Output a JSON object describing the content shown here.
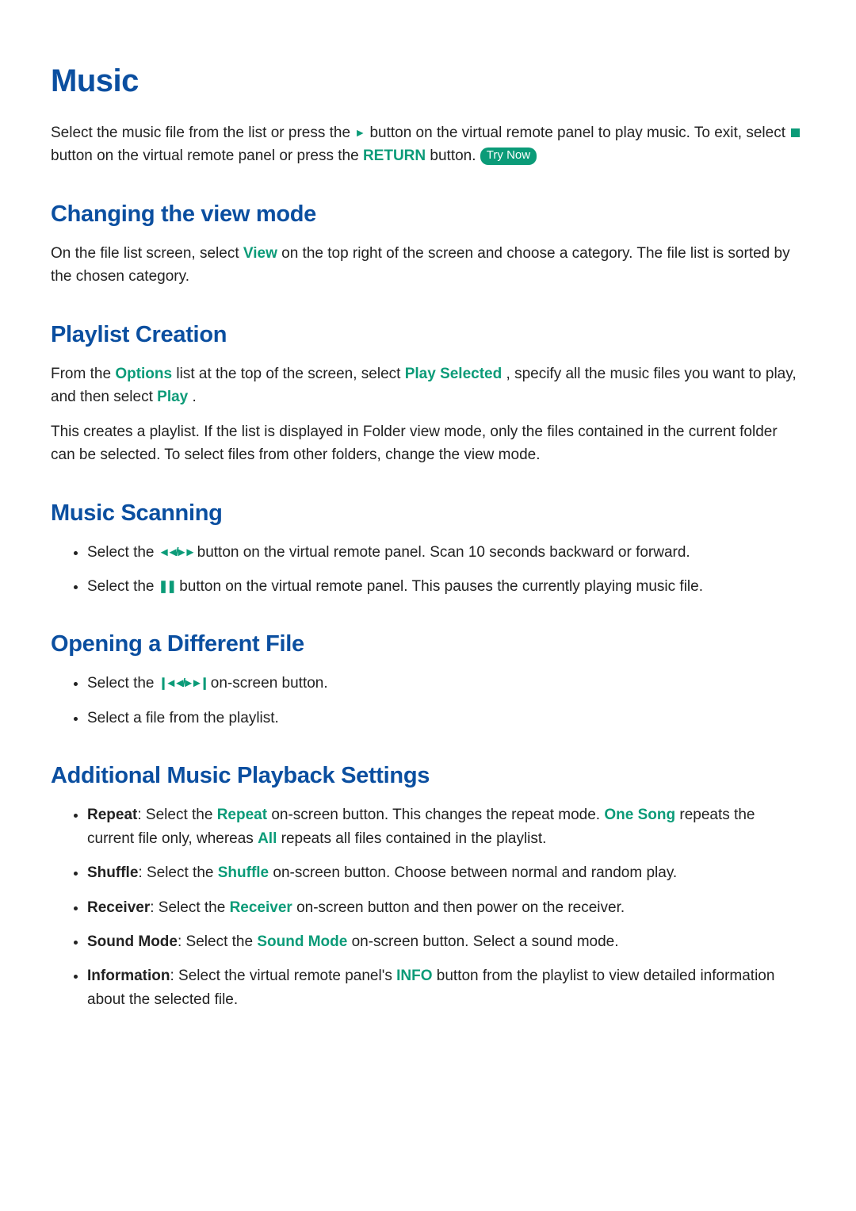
{
  "title": "Music",
  "intro": {
    "t1": "Select the music file from the list or press the ",
    "play_icon": "►",
    "t2": " button on the virtual remote panel to play music. To exit, select ",
    "stop_icon": "■",
    "t3": " button on the virtual remote panel or press the ",
    "return_label": "RETURN",
    "t4": " button. ",
    "try_now": "Try Now"
  },
  "sections": {
    "view": {
      "heading": "Changing the view mode",
      "p1a": "On the file list screen, select ",
      "view_label": "View",
      "p1b": " on the top right of the screen and choose a category. The file list is sorted by the chosen category."
    },
    "playlist": {
      "heading": "Playlist Creation",
      "p1a": "From the ",
      "options_label": "Options",
      "p1b": " list at the top of the screen, select ",
      "play_selected_label": "Play Selected",
      "p1c": ", specify all the music files you want to play, and then select ",
      "play_label": "Play",
      "p1d": ".",
      "p2": "This creates a playlist. If the list is displayed in Folder view mode, only the files contained in the current folder can be selected. To select files from other folders, change the view mode."
    },
    "scanning": {
      "heading": "Music Scanning",
      "li1a": "Select the ",
      "scan_icons": "◄◄/►►",
      "li1b": " button on the virtual remote panel. Scan 10 seconds backward or forward.",
      "li2a": "Select the ",
      "pause_icon": "❚❚",
      "li2b": " button on the virtual remote panel. This pauses the currently playing music file."
    },
    "different": {
      "heading": "Opening a Different File",
      "li1a": "Select the ",
      "skip_icons": "❙◄◄/►►❙",
      "li1b": " on-screen button.",
      "li2": "Select a file from the playlist."
    },
    "additional": {
      "heading": "Additional Music Playback Settings",
      "repeat": {
        "label": "Repeat",
        "t1": ": Select the ",
        "btn": "Repeat",
        "t2": " on-screen button. This changes the repeat mode. ",
        "one_song": "One Song",
        "t3": " repeats the current file only, whereas ",
        "all": "All",
        "t4": " repeats all files contained in the playlist."
      },
      "shuffle": {
        "label": "Shuffle",
        "t1": ": Select the ",
        "btn": "Shuffle",
        "t2": " on-screen button. Choose between normal and random play."
      },
      "receiver": {
        "label": "Receiver",
        "t1": ": Select the ",
        "btn": "Receiver",
        "t2": " on-screen button and then power on the receiver."
      },
      "sound": {
        "label": "Sound Mode",
        "t1": ": Select the ",
        "btn": "Sound Mode",
        "t2": " on-screen button. Select a sound mode."
      },
      "info": {
        "label": "Information",
        "t1": ": Select the virtual remote panel's ",
        "btn": "INFO",
        "t2": " button from the playlist to view detailed information about the selected file."
      }
    }
  }
}
